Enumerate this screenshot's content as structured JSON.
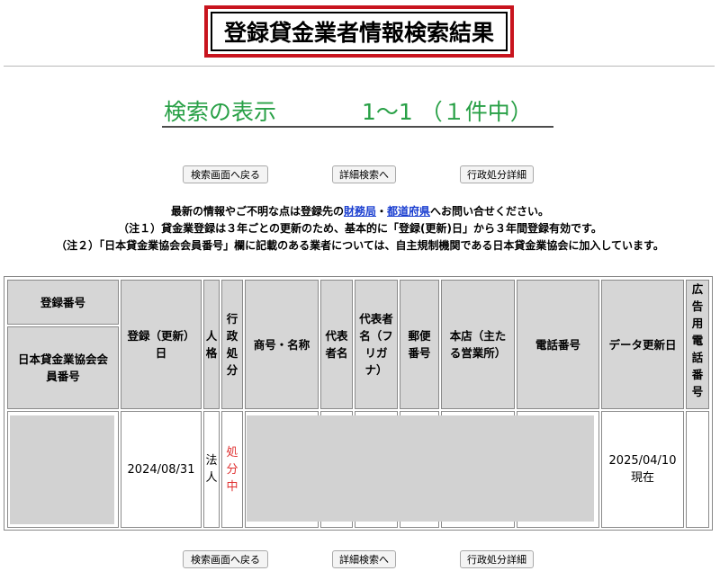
{
  "page": {
    "title": "登録貸金業者情報検索結果",
    "result_label": "検索の表示",
    "result_range": "1〜1 （１件中）"
  },
  "buttons": {
    "back": "検索画面へ戻る",
    "detail_search": "詳細検索へ",
    "disposition": "行政処分詳細"
  },
  "notes": {
    "line1_pre": "最新の情報やご不明な点は登録先の",
    "link_zaimukyoku": "財務局",
    "line1_sep": "・",
    "link_todofuken": "都道府県",
    "line1_post": "へお問い合せください。",
    "line2": "（注１）貸金業登録は３年ごとの更新のため、基本的に「登録(更新)日」から３年間登録有効です。",
    "line3": "（注２）「日本貸金業協会会員番号」欄に記載のある業者については、自主規制機関である日本貸金業協会に加入しています。"
  },
  "table": {
    "headers": {
      "reg_no": "登録番号",
      "assoc_no": "日本貸金業協会会員番号",
      "reg_date": "登録（更新）日",
      "entity": "人格",
      "disposition": "行政処分",
      "trade_name": "商号・名称",
      "rep_name": "代表者名",
      "rep_kana": "代表者名（フリガナ）",
      "postal": "郵便番号",
      "head_office": "本店（主たる営業所）",
      "phone": "電話番号",
      "updated": "データ更新日",
      "ad_phone": "広告用電話番号"
    },
    "row": {
      "reg_date": "2024/08/31",
      "entity": "法人",
      "disposition": "処分中",
      "updated": "2025/04/10現在"
    }
  }
}
